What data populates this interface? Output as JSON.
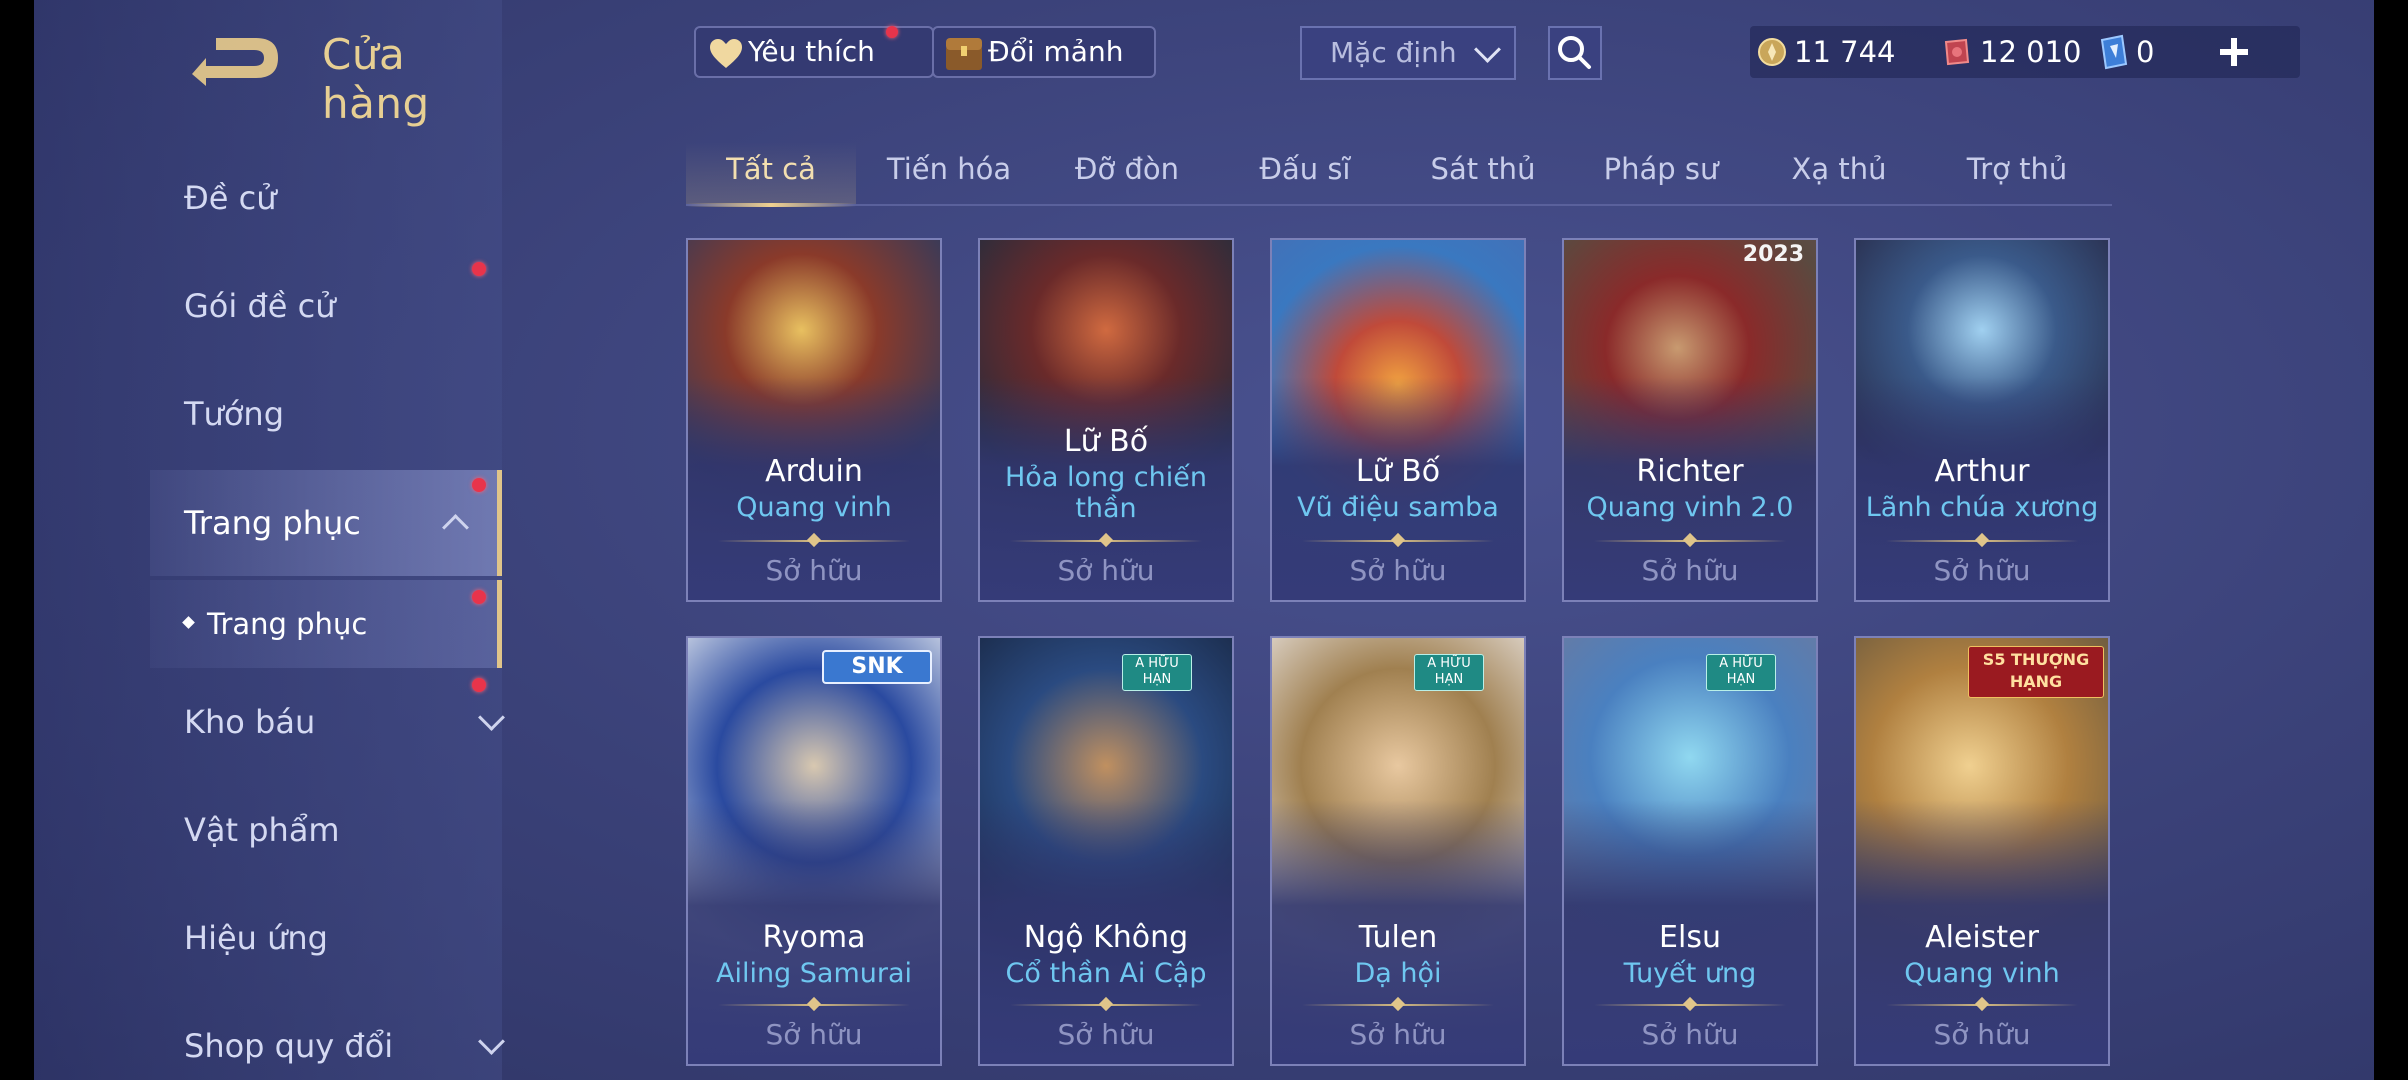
{
  "header": {
    "title": "Cửa hàng",
    "favorites_label": "Yêu thích",
    "exchange_label": "Đổi mảnh",
    "sort_value": "Mặc định",
    "currencies": {
      "gold": "11 744",
      "vouchers": "12 010",
      "gems": "0"
    }
  },
  "sidebar": {
    "items": [
      {
        "label": "Đề cử"
      },
      {
        "label": "Gói đề cử"
      },
      {
        "label": "Tướng"
      },
      {
        "label": "Trang phục"
      },
      {
        "label": "Trang phục"
      },
      {
        "label": "Kho báu"
      },
      {
        "label": "Vật phẩm"
      },
      {
        "label": "Hiệu ứng"
      },
      {
        "label": "Shop quy đổi"
      }
    ]
  },
  "tabs": [
    "Tất cả",
    "Tiến hóa",
    "Đỡ đòn",
    "Đấu sĩ",
    "Sát thủ",
    "Pháp sư",
    "Xạ thủ",
    "Trợ thủ"
  ],
  "cards": [
    {
      "hero": "Arduin",
      "skin": "Quang vinh",
      "status": "Sở hữu"
    },
    {
      "hero": "Lữ Bố",
      "skin": "Hỏa long chiến thần",
      "status": "Sở hữu"
    },
    {
      "hero": "Lữ Bố",
      "skin": "Vũ điệu samba",
      "status": "Sở hữu"
    },
    {
      "hero": "Richter",
      "skin": "Quang vinh 2.0",
      "status": "Sở hữu",
      "badge": "2023"
    },
    {
      "hero": "Arthur",
      "skin": "Lãnh chúa xương",
      "status": "Sở hữu"
    },
    {
      "hero": "Ryoma",
      "skin": "Ailing Samurai",
      "status": "Sở hữu",
      "badge": "SNK"
    },
    {
      "hero": "Ngộ Không",
      "skin": "Cổ thần Ai Cập",
      "status": "Sở hữu",
      "badge": "A HỮU HẠN"
    },
    {
      "hero": "Tulen",
      "skin": "Dạ hội",
      "status": "Sở hữu",
      "badge": "A HỮU HẠN"
    },
    {
      "hero": "Elsu",
      "skin": "Tuyết ưng",
      "status": "Sở hữu",
      "badge": "A HỮU HẠN"
    },
    {
      "hero": "Aleister",
      "skin": "Quang vinh",
      "status": "Sở hữu",
      "badge": "S5 THƯỢNG HẠNG"
    }
  ],
  "colors": {
    "accent_gold": "#e0c58a",
    "skin_name": "#6fc7f0",
    "notification_dot": "#e8344b",
    "background": "#3a4178"
  }
}
